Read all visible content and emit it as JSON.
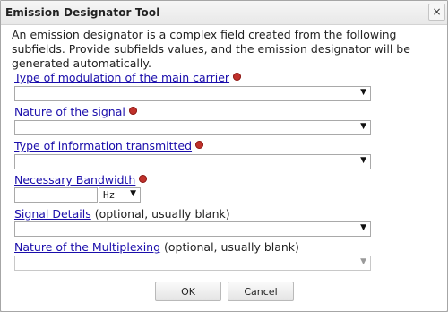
{
  "dialog": {
    "title": "Emission Designator Tool",
    "close_symbol": "×",
    "description": "An emission designator is a complex field created from the following subfields. Provide subfields values, and the emission designator will be generated automatically."
  },
  "fields": {
    "modulation": {
      "label": "Type of modulation of the main carrier",
      "value": ""
    },
    "signal_nature": {
      "label": "Nature of the signal",
      "value": ""
    },
    "information": {
      "label": "Type of information transmitted",
      "value": ""
    },
    "bandwidth": {
      "label": "Necessary Bandwidth",
      "value": "",
      "unit": "Hz"
    },
    "signal_details": {
      "label": "Signal Details",
      "note": " (optional, usually blank)",
      "value": ""
    },
    "multiplexing": {
      "label": "Nature of the Multiplexing",
      "note": " (optional, usually blank)",
      "value": ""
    }
  },
  "buttons": {
    "ok": "OK",
    "cancel": "Cancel"
  },
  "icons": {
    "dropdown": "▼",
    "required_marker": "required-icon",
    "close": "close-icon"
  },
  "colors": {
    "link": "#1a0dab",
    "required": "#c0312b",
    "title_bar": "#e8e8e8"
  }
}
